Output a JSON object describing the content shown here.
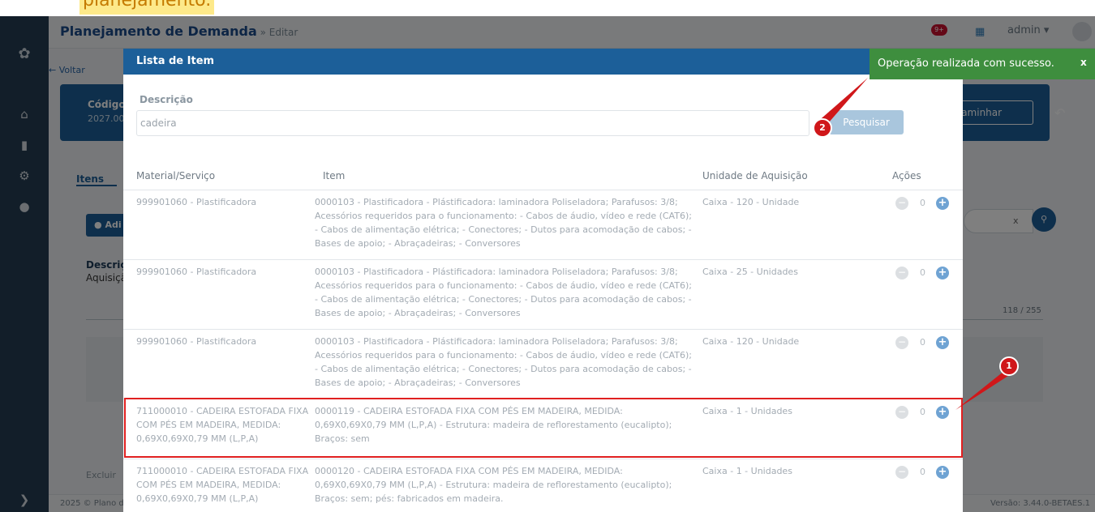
{
  "top_note": "planejamento.",
  "sidebar": {
    "icons": [
      "leaf-logo-icon",
      "home-icon",
      "file-icon",
      "gear-icon",
      "lightbulb-icon",
      "expand-icon"
    ]
  },
  "background": {
    "page_title": "Planejamento de Demanda",
    "page_subtitle": " » Editar",
    "notif_count": "9+",
    "user": "admin",
    "back": "← Voltar",
    "code_label": "Código",
    "code_value": "2027.00",
    "encaminhar": "ncaminhar",
    "tab_itens": "Itens",
    "add_button": "Adi",
    "desc_label": "Descriçã",
    "desc_value": "Aquisiçã",
    "search_clear": "x",
    "counter": "118 / 255",
    "excluir": "Excluir",
    "footer_left": "2025 © Plano de",
    "footer_right": "Versão: 3.44.0-BETAES.1"
  },
  "modal": {
    "title": "Lista de Item",
    "desc_label": "Descrição",
    "desc_value": "cadeira",
    "search_button": "Pesquisar",
    "columns": [
      "Material/Serviço",
      "Item",
      "Unidade de Aquisição",
      "Ações"
    ],
    "rows": [
      {
        "material": "999901060 - Plastificadora",
        "item": "0000103 - Plastificadora - Plástificadora: laminadora Poliseladora; Parafusos: 3/8; Acessórios requeridos para o funcionamento: - Cabos de áudio, vídeo e rede (CAT6); - Cabos de alimentação elétrica; - Conectores; - Dutos para acomodação de cabos; - Bases de apoio; - Abraçadeiras; - Conversores",
        "unit": "Caixa - 120 - Unidade",
        "qty": "0"
      },
      {
        "material": "999901060 - Plastificadora",
        "item": "0000103 - Plastificadora - Plástificadora: laminadora Poliseladora; Parafusos: 3/8; Acessórios requeridos para o funcionamento: - Cabos de áudio, vídeo e rede (CAT6); - Cabos de alimentação elétrica; - Conectores; - Dutos para acomodação de cabos; - Bases de apoio; - Abraçadeiras; - Conversores",
        "unit": "Caixa - 25 - Unidades",
        "qty": "0"
      },
      {
        "material": "999901060 - Plastificadora",
        "item": "0000103 - Plastificadora - Plástificadora: laminadora Poliseladora; Parafusos: 3/8; Acessórios requeridos para o funcionamento: - Cabos de áudio, vídeo e rede (CAT6); - Cabos de alimentação elétrica; - Conectores; - Dutos para acomodação de cabos; - Bases de apoio; - Abraçadeiras; - Conversores",
        "unit": "Caixa - 120 - Unidade",
        "qty": "0"
      },
      {
        "material": "711000010 - CADEIRA ESTOFADA FIXA COM PÉS EM MADEIRA, MEDIDA: 0,69X0,69X0,79 MM (L,P,A)",
        "item": "0000119 - CADEIRA ESTOFADA FIXA COM PÉS EM MADEIRA, MEDIDA: 0,69X0,69X0,79 MM (L,P,A) - Estrutura: madeira de reflorestamento (eucalipto); Braços: sem",
        "unit": "Caixa - 1 - Unidades",
        "qty": "0"
      },
      {
        "material": "711000010 - CADEIRA ESTOFADA FIXA COM PÉS EM MADEIRA, MEDIDA: 0,69X0,69X0,79 MM (L,P,A)",
        "item": "0000120 - CADEIRA ESTOFADA FIXA COM PÉS EM MADEIRA, MEDIDA: 0,69X0,69X0,79 MM (L,P,A) - Estrutura: madeira de reflorestamento (eucalipto); Braços: sem; pés: fabricados em madeira.",
        "unit": "Caixa - 1 - Unidades",
        "qty": "0"
      }
    ]
  },
  "toast": {
    "message": "Operação realizada com sucesso.",
    "close": "x"
  },
  "callouts": {
    "badge_1": "1",
    "badge_2": "2",
    "color": "#d0171a"
  }
}
